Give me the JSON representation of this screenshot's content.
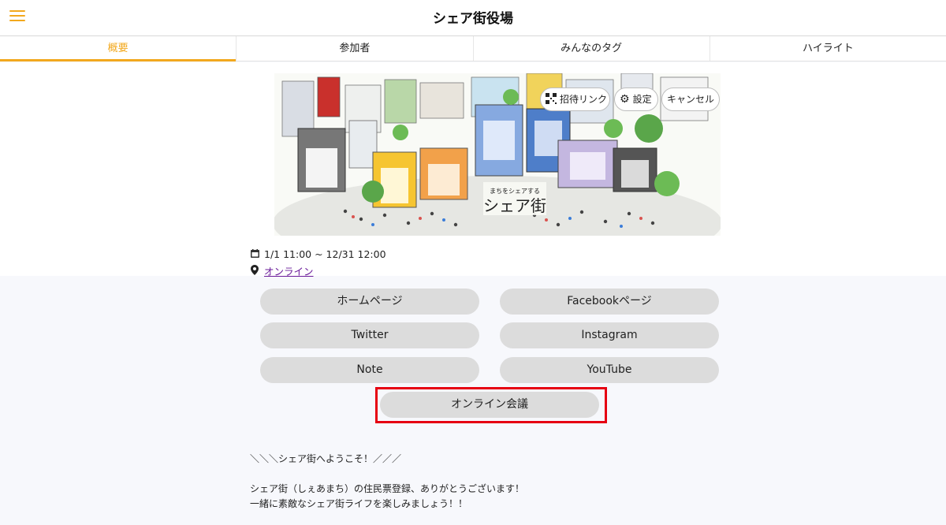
{
  "header": {
    "title": "シェア街役場"
  },
  "tabs": [
    {
      "label": "概要",
      "active": true
    },
    {
      "label": "参加者",
      "active": false
    },
    {
      "label": "みんなのタグ",
      "active": false
    },
    {
      "label": "ハイライト",
      "active": false
    }
  ],
  "cover": {
    "logo_sub": "まちをシェアする",
    "logo_main": "シェア街",
    "buttons": {
      "invite_label": "招待リンク",
      "settings_label": "設定",
      "cancel_label": "キャンセル"
    }
  },
  "event": {
    "datetime": "1/1 11:00 ~ 12/31 12:00",
    "location": "オンライン"
  },
  "links": {
    "homepage": "ホームページ",
    "facebook": "Facebookページ",
    "twitter": "Twitter",
    "instagram": "Instagram",
    "note": "Note",
    "youtube": "YouTube",
    "online_meeting": "オンライン会議"
  },
  "description": {
    "line1": "＼＼＼シェア街へようこそ！／／／",
    "line2": "シェア街（しぇあまち）の住民票登録、ありがとうございます！",
    "line3": "一緒に素敵なシェア街ライフを楽しみましょう！！"
  },
  "colors": {
    "accent": "#f2a81d",
    "highlight": "#e60012",
    "button_bg": "#dcdcdc",
    "link": "#6a1b9a"
  }
}
